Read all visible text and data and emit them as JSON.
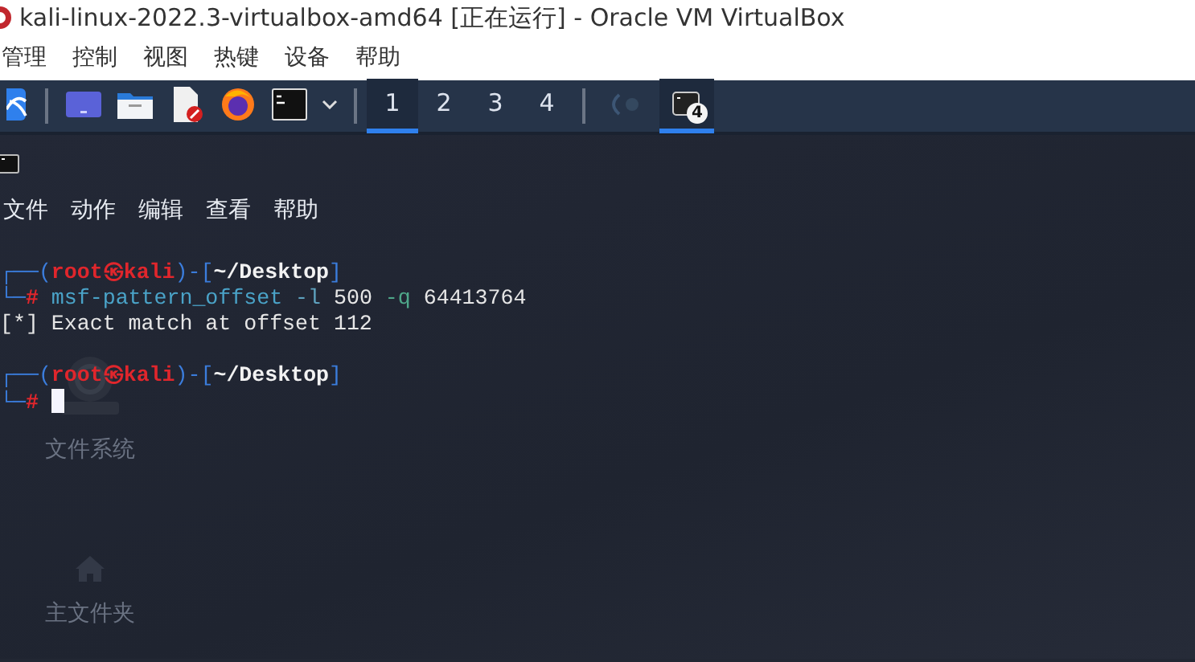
{
  "window": {
    "title": "kali-linux-2022.3-virtualbox-amd64 [正在运行] - Oracle VM VirtualBox"
  },
  "menu_bar": [
    "管理",
    "控制",
    "视图",
    "热键",
    "设备",
    "帮助"
  ],
  "panel": {
    "workspaces": [
      {
        "label": "1",
        "selected": true
      },
      {
        "label": "2",
        "selected": false
      },
      {
        "label": "3",
        "selected": false
      },
      {
        "label": "4",
        "selected": false
      }
    ],
    "tasks": [
      {
        "kind": "debugger",
        "selected": false
      },
      {
        "kind": "terminal",
        "badge": "4",
        "selected": true
      }
    ]
  },
  "desktop_icons": [
    {
      "kind": "drive",
      "label": "文件系统"
    },
    {
      "kind": "home",
      "label": "主文件夹"
    }
  ],
  "terminal": {
    "menu": [
      "文件",
      "动作",
      "编辑",
      "查看",
      "帮助"
    ],
    "lines": [
      {
        "segments": [
          {
            "kind": "frame",
            "text": "┌──("
          },
          {
            "kind": "user",
            "text": "root㉿kali"
          },
          {
            "kind": "frame",
            "text": ")-["
          },
          {
            "kind": "path",
            "text": "~/Desktop"
          },
          {
            "kind": "frame",
            "text": "]"
          }
        ]
      },
      {
        "segments": [
          {
            "kind": "frame",
            "text": "└─"
          },
          {
            "kind": "prompt",
            "text": "#"
          },
          {
            "kind": "command",
            "text": " msf-pattern_offset"
          },
          {
            "kind": "option",
            "text": " -l"
          },
          {
            "kind": "plain",
            "text": " 500 "
          },
          {
            "kind": "option2",
            "text": "-q"
          },
          {
            "kind": "plain",
            "text": " 64413764"
          }
        ]
      },
      {
        "segments": [
          {
            "kind": "plain",
            "text": "[*] Exact match at offset 112"
          }
        ]
      },
      {
        "segments": [
          {
            "kind": "frame",
            "text": "┌──("
          },
          {
            "kind": "user",
            "text": "root㉿kali"
          },
          {
            "kind": "frame",
            "text": ")-["
          },
          {
            "kind": "path",
            "text": "~/Desktop"
          },
          {
            "kind": "frame",
            "text": "]"
          }
        ]
      },
      {
        "segments": [
          {
            "kind": "frame",
            "text": "└─"
          },
          {
            "kind": "prompt",
            "text": "#"
          },
          {
            "kind": "cursor"
          }
        ]
      }
    ]
  }
}
